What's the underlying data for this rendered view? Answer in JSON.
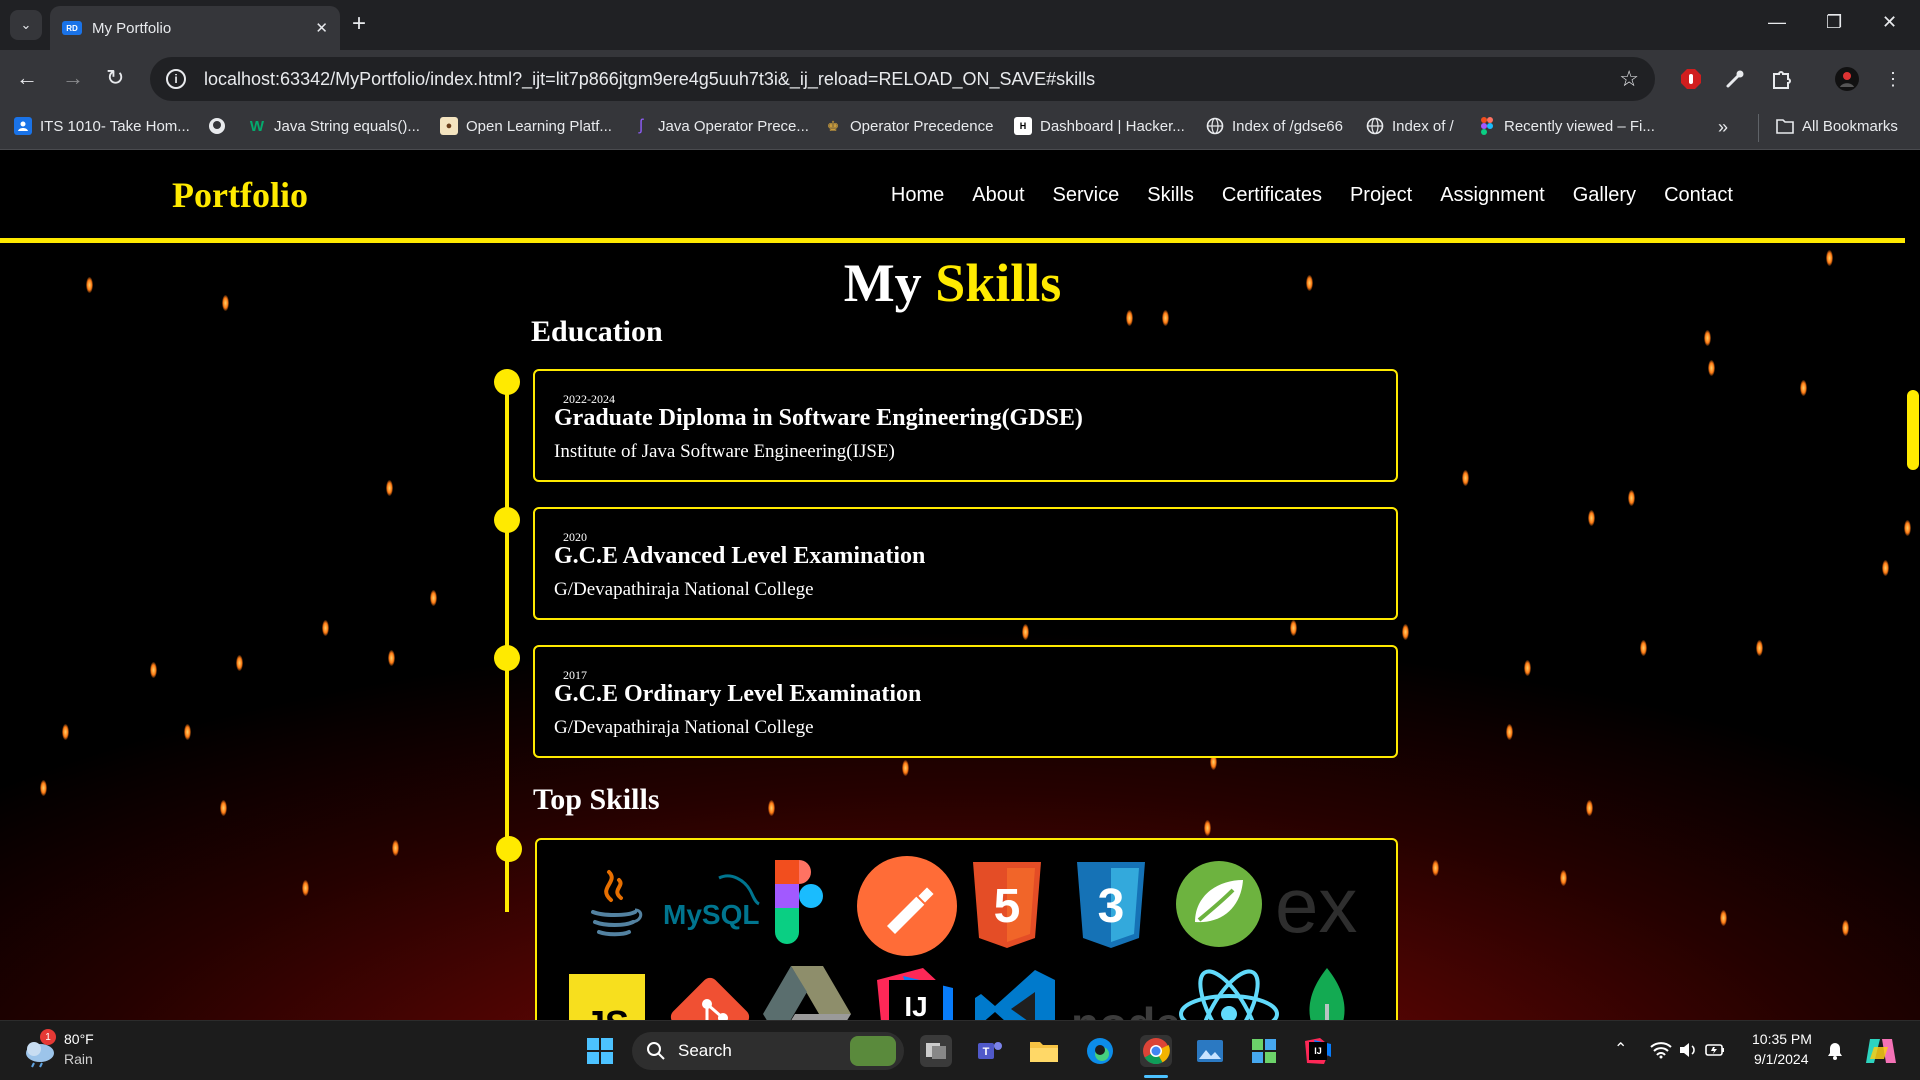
{
  "browser": {
    "tab_title": "My Portfolio",
    "tab_favicon_text": "RD",
    "url": "localhost:63342/MyPortfolio/index.html?_ijt=lit7p866jtgm9ere4g5uuh7t3i&_ij_reload=RELOAD_ON_SAVE#skills",
    "bookmarks": [
      {
        "label": "ITS 1010- Take Hom...",
        "icon": "classroom-icon",
        "color": "#1a73e8"
      },
      {
        "label": "",
        "icon": "github-icon",
        "color": "#e8eaed"
      },
      {
        "label": "Java String equals()...",
        "icon": "w3-icon",
        "color": "#04aa6d"
      },
      {
        "label": "Open Learning Platf...",
        "icon": "ol-icon",
        "color": "#c8a060"
      },
      {
        "label": "Java Operator Prece...",
        "icon": "operator-icon",
        "color": "#8e5cf7"
      },
      {
        "label": "Operator Precedence",
        "icon": "crown-icon",
        "color": "#c89b3c"
      },
      {
        "label": "Dashboard | Hacker...",
        "icon": "hackerrank-icon",
        "color": "#ffffff"
      },
      {
        "label": "Index of /gdse66",
        "icon": "globe-icon",
        "color": "#e8eaed"
      },
      {
        "label": "Index of /",
        "icon": "globe-icon",
        "color": "#e8eaed"
      },
      {
        "label": "Recently viewed – Fi...",
        "icon": "figma-icon",
        "color": "#f24e1e"
      }
    ],
    "more_label": "»",
    "all_bookmarks_label": "All Bookmarks"
  },
  "site": {
    "logo": "Portfolio",
    "nav": [
      "Home",
      "About",
      "Service",
      "Skills",
      "Certificates",
      "Project",
      "Assignment",
      "Gallery",
      "Contact"
    ],
    "section_title_part1": "My ",
    "section_title_part2": "Skills",
    "education_heading": "Education",
    "education": [
      {
        "year": "2022-2024",
        "title": "Graduate Diploma in Software Engineering(GDSE)",
        "institute": "Institute of Java Software Engineering(IJSE)"
      },
      {
        "year": "2020",
        "title": "G.C.E Advanced Level Examination",
        "institute": "G/Devapathiraja National College"
      },
      {
        "year": "2017",
        "title": "G.C.E Ordinary Level Examination",
        "institute": "G/Devapathiraja National College"
      }
    ],
    "top_skills_heading": "Top Skills",
    "skills": [
      {
        "name": "java-icon"
      },
      {
        "name": "mysql-icon",
        "text": "MySQL"
      },
      {
        "name": "figma-icon"
      },
      {
        "name": "postman-icon"
      },
      {
        "name": "html5-icon",
        "text": "5"
      },
      {
        "name": "css3-icon",
        "text": "3"
      },
      {
        "name": "spring-icon"
      },
      {
        "name": "express-icon",
        "text": "ex"
      },
      {
        "name": "javascript-icon",
        "text": "JS"
      },
      {
        "name": "git-icon"
      },
      {
        "name": "google-drive-icon"
      },
      {
        "name": "intellij-icon",
        "text": "IJ"
      },
      {
        "name": "vscode-icon"
      },
      {
        "name": "nodejs-icon",
        "text": "node"
      },
      {
        "name": "react-icon"
      },
      {
        "name": "mongodb-icon"
      }
    ],
    "accent": "#ffea00"
  },
  "taskbar": {
    "weather_temp": "80°F",
    "weather_desc": "Rain",
    "weather_badge": "1",
    "search_label": "Search",
    "time": "10:35 PM",
    "date": "9/1/2024"
  }
}
